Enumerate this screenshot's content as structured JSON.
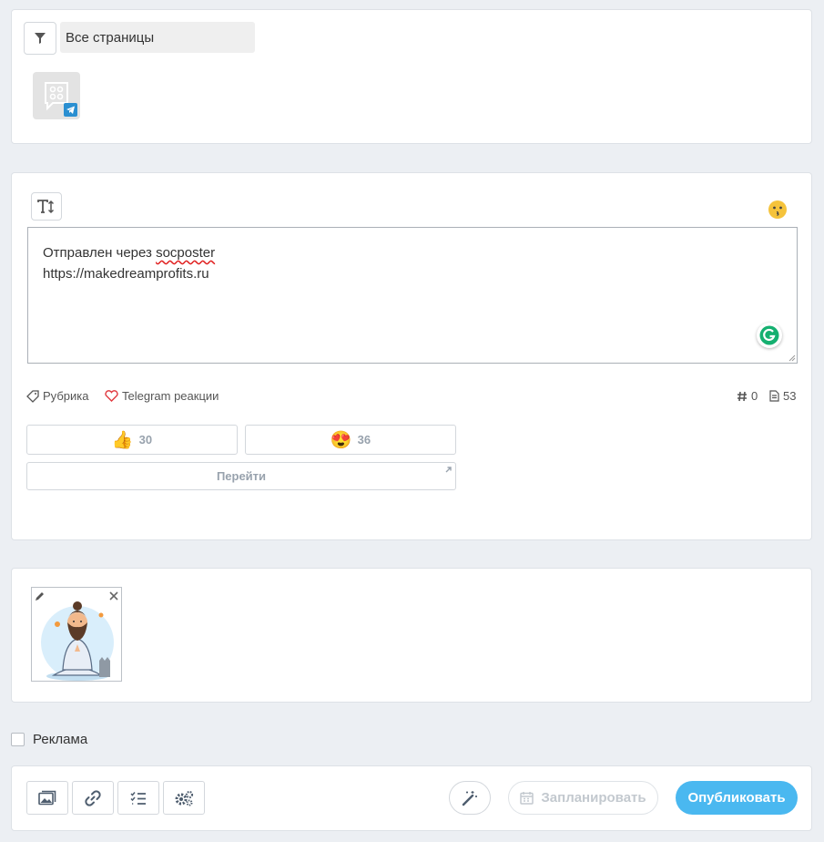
{
  "filter": {
    "selected": "Все страницы"
  },
  "editor": {
    "line1_prefix": "Отправлен через ",
    "line1_word": "socposter",
    "line2": "https://makedreamprofits.ru"
  },
  "meta": {
    "rubric_label": "Рубрика",
    "reactions_label": "Telegram реакции",
    "hashtag_count": "0",
    "char_count": "53"
  },
  "reactions": [
    {
      "emoji": "👍",
      "count": "30"
    },
    {
      "emoji": "😍",
      "count": "36"
    }
  ],
  "goto_label": "Перейти",
  "advert": {
    "label": "Реклама",
    "checked": false
  },
  "footer": {
    "schedule_label": "Запланировать",
    "publish_label": "Опубликовать"
  },
  "colors": {
    "background": "#eceff3",
    "publish": "#4ab8f0",
    "telegram": "#2a8fd1",
    "heart": "#e0373d",
    "grammarly": "#15b070"
  },
  "icons": [
    "filter-icon",
    "telegram-icon",
    "text-size-icon",
    "emoji-icon",
    "grammarly-icon",
    "tag-icon",
    "heart-icon",
    "hashtag-icon",
    "document-icon",
    "external-link-icon",
    "pencil-icon",
    "close-icon",
    "image-icon",
    "link-icon",
    "checklist-icon",
    "gears-icon",
    "magic-wand-icon",
    "calendar-icon"
  ]
}
